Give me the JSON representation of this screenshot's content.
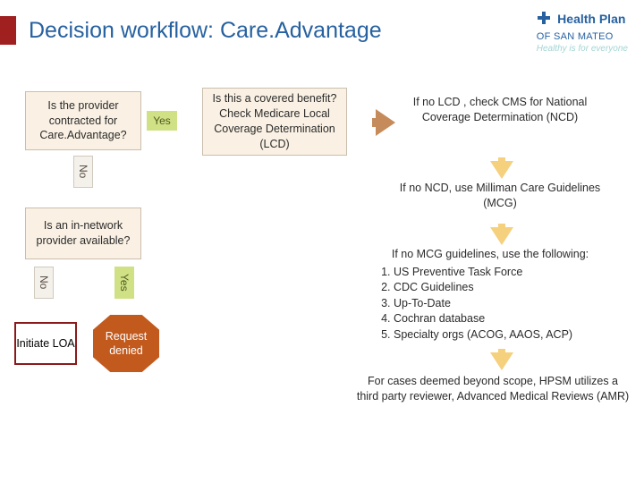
{
  "header": {
    "title": "Decision workflow: Care.Advantage"
  },
  "logo": {
    "line1": "Health Plan",
    "line2": "OF SAN MATEO",
    "tagline": "Healthy is for everyone"
  },
  "nodes": {
    "q1": "Is the provider contracted for Care.Advantage?",
    "q2": "Is this a covered benefit? Check Medicare Local Coverage Determination (LCD)",
    "q3": "If no LCD , check CMS for National Coverage Determination (NCD)",
    "q4": "If no NCD, use Milliman Care Guidelines (MCG)",
    "q5_header": "If no MCG guidelines, use the following:",
    "q5_items": [
      "US Preventive Task Force",
      "CDC Guidelines",
      "Up-To-Date",
      "Cochran database",
      "Specialty orgs (ACOG, AAOS, ACP)"
    ],
    "q6": "For cases deemed beyond scope, HPSM utilizes a third party reviewer, Advanced Medical Reviews (AMR)",
    "in_network": "Is an in-network provider available?",
    "initiate": "Initiate LOA",
    "denied": "Request denied"
  },
  "labels": {
    "yes": "Yes",
    "no": "No"
  }
}
